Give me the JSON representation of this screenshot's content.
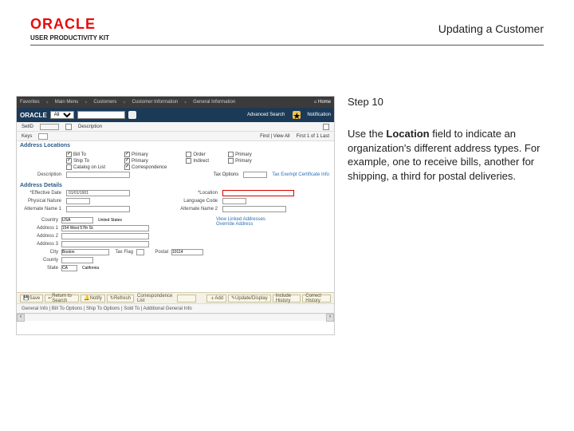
{
  "brand": {
    "name": "ORACLE",
    "product": "USER PRODUCTIVITY KIT"
  },
  "page": {
    "title": "Updating a Customer"
  },
  "app": {
    "menu": [
      "Favorites",
      "Main Menu",
      "Customers",
      "Customer Information",
      "General Information"
    ],
    "home": "Home",
    "search": {
      "type": "All",
      "advanced": "Advanced Search"
    },
    "notifications": "Notification",
    "status": "General Info | Bill To Options | Ship To Options | Sold To | Additional General Info"
  },
  "form": {
    "set_id_label": "SetID",
    "description_label": "Description",
    "keys_label": "Keys",
    "find_view": "Find | View All",
    "first_of": "First  1 of 1  Last",
    "tax_label": "Tax Options",
    "tax_link": "Tax Exempt Certificate Info",
    "eff_date_label": "*Effective Date",
    "eff_date_value": "01/01/1901",
    "physical_nature_label": "Physical Nature",
    "alt_name1_label": "Alternate Name 1",
    "alt_name2_label": "Alternate Name 2",
    "location_label": "*Location",
    "lang_code_label": "Language Code",
    "sections": {
      "address_locations": "Address Locations",
      "address_details": "Address Details"
    },
    "checks": {
      "bill_to": "Bill To",
      "ship_to": "Ship To",
      "cat": "Catalog on List",
      "primary": "Primary",
      "corresp": "Correspondence",
      "order": "Order",
      "indirect": "Indirect"
    }
  },
  "addr": {
    "country_label": "Country",
    "country_value": "USA",
    "country_name": "United States",
    "addr1_label": "Address 1",
    "addr1_value": "154 West 57th St.",
    "addr2_label": "Address 2",
    "addr3_label": "Address 3",
    "city_label": "City",
    "city_value": "Boston",
    "tax_flag_label": "Tax Flag",
    "postal_label": "Postal",
    "postal_value": "10114",
    "county_label": "County",
    "state_label": "State",
    "state_value": "CA",
    "state_name": "California",
    "links": [
      "View Linked Addresses",
      "Override Address"
    ]
  },
  "toolbar": {
    "save": "Save",
    "return": "Return to Search",
    "notify": "Notify",
    "refresh": "Refresh",
    "corr_list": "Correspondence List",
    "add": "Add",
    "update": "Update/Display",
    "history": "Include History",
    "correct": "Correct History"
  },
  "instruction": {
    "step": "Step 10",
    "bold": "Location",
    "body": [
      "Use the ",
      " field to indicate an organization's different address types. For example, one to receive bills, another for shipping, a third for postal deliveries."
    ]
  }
}
